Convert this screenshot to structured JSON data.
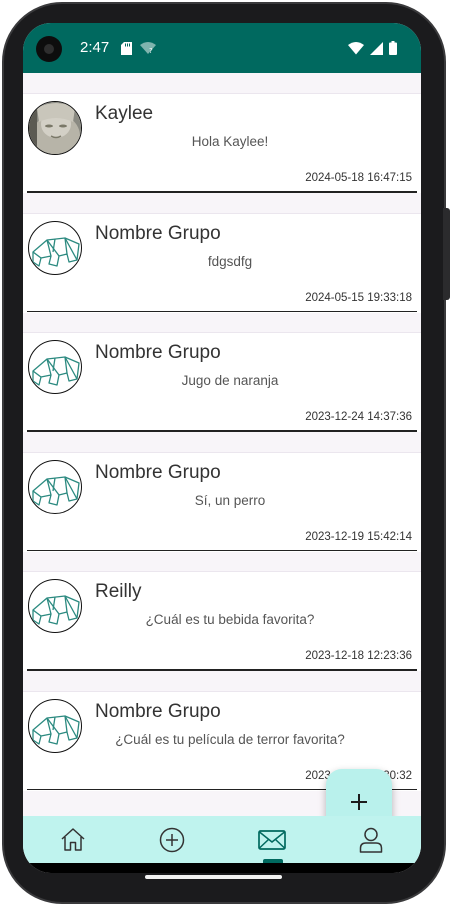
{
  "status_bar": {
    "time": "2:47",
    "left_icons": [
      "sd-card-icon",
      "wifi-question-icon"
    ],
    "right_icons": [
      "wifi-icon",
      "signal-icon",
      "battery-icon"
    ],
    "color": "#00695f"
  },
  "chats": [
    {
      "name": "Kaylee",
      "message": "Hola Kaylee!",
      "timestamp": "2024-05-18 16:47:15",
      "avatar": "photo-avatar"
    },
    {
      "name": "Nombre Grupo",
      "message": "fdgsdfg",
      "timestamp": "2024-05-15 19:33:18",
      "avatar": "origami-avatar"
    },
    {
      "name": "Nombre Grupo",
      "message": "Jugo de naranja",
      "timestamp": "2023-12-24 14:37:36",
      "avatar": "origami-avatar"
    },
    {
      "name": "Nombre Grupo",
      "message": "Sí, un perro",
      "timestamp": "2023-12-19 15:42:14",
      "avatar": "origami-avatar"
    },
    {
      "name": "Reilly",
      "message": "¿Cuál es tu bebida favorita?",
      "timestamp": "2023-12-18 12:23:36",
      "avatar": "origami-avatar"
    },
    {
      "name": "Nombre Grupo",
      "message": "¿Cuál es tu película de terror favorita?",
      "timestamp": "2023-12-15 10:30:32",
      "avatar": "origami-avatar"
    }
  ],
  "fab": {
    "icon": "plus-icon",
    "label": "+"
  },
  "bottom_nav": {
    "items": [
      {
        "icon": "home-icon"
      },
      {
        "icon": "add-circle-icon"
      },
      {
        "icon": "mail-icon",
        "active": true
      },
      {
        "icon": "user-icon"
      }
    ],
    "background": "#bff3ee",
    "accent": "#00695f"
  }
}
